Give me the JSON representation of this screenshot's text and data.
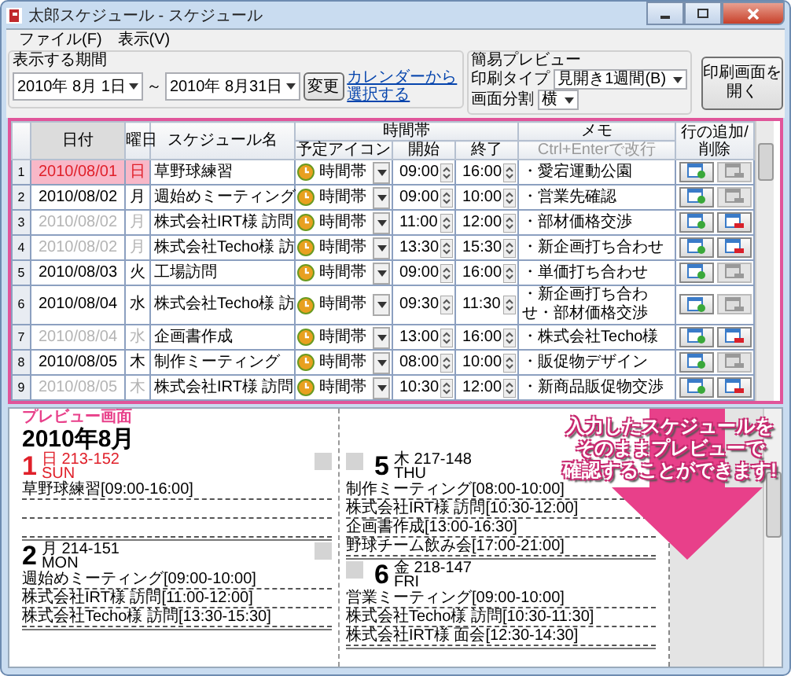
{
  "window": {
    "title": "太郎スケジュール - スケジュール"
  },
  "menu": [
    "ファイル(F)",
    "表示(V)"
  ],
  "period": {
    "label": "表示する期間",
    "from": "2010年 8月 1日",
    "separator": "～",
    "to": "2010年 8月31日",
    "change_button": "変更",
    "calendar_link": "カレンダーから選択する"
  },
  "preview_settings": {
    "label": "簡易プレビュー",
    "print_type_label": "印刷タイプ",
    "print_type": "見開き1週間(B)",
    "split_label": "画面分割",
    "split": "横"
  },
  "open_print_button": "印刷画面を開く",
  "grid": {
    "headers": {
      "date": "日付",
      "weekday": "曜日",
      "name": "スケジュール名",
      "time_group": "時間帯",
      "icon": "予定アイコン",
      "start": "開始",
      "end": "終了",
      "memo": "メモ",
      "memo_hint": "Ctrl+Enterで改行",
      "actions": "行の追加/削除"
    },
    "rows": [
      {
        "no": "1",
        "date": "2010/08/01",
        "weekday": "日",
        "name": "草野球練習",
        "icon_label": "時間帯",
        "start": "09:00",
        "end": "16:00",
        "memo": "・愛宕運動公園",
        "greyed": false,
        "selected": true,
        "holiday": true,
        "can_delete": false
      },
      {
        "no": "2",
        "date": "2010/08/02",
        "weekday": "月",
        "name": "週始めミーティング",
        "icon_label": "時間帯",
        "start": "09:00",
        "end": "10:00",
        "memo": "・営業先確認",
        "greyed": false,
        "selected": false,
        "holiday": false,
        "can_delete": false
      },
      {
        "no": "3",
        "date": "2010/08/02",
        "weekday": "月",
        "name": "株式会社IRT様 訪問",
        "icon_label": "時間帯",
        "start": "11:00",
        "end": "12:00",
        "memo": "・部材価格交渉",
        "greyed": true,
        "selected": false,
        "holiday": false,
        "can_delete": true
      },
      {
        "no": "4",
        "date": "2010/08/02",
        "weekday": "月",
        "name": "株式会社Techo様 訪",
        "icon_label": "時間帯",
        "start": "13:30",
        "end": "15:30",
        "memo": "・新企画打ち合わせ",
        "greyed": true,
        "selected": false,
        "holiday": false,
        "can_delete": true
      },
      {
        "no": "5",
        "date": "2010/08/03",
        "weekday": "火",
        "name": "工場訪問",
        "icon_label": "時間帯",
        "start": "09:00",
        "end": "16:00",
        "memo": "・単価打ち合わせ",
        "greyed": false,
        "selected": false,
        "holiday": false,
        "can_delete": false
      },
      {
        "no": "6",
        "date": "2010/08/04",
        "weekday": "水",
        "name": "株式会社Techo様 訪",
        "icon_label": "時間帯",
        "start": "09:30",
        "end": "11:30",
        "memo": "・新企画打ち合わせ・部材価格交渉",
        "greyed": false,
        "selected": false,
        "holiday": false,
        "can_delete": false
      },
      {
        "no": "7",
        "date": "2010/08/04",
        "weekday": "水",
        "name": "企画書作成",
        "icon_label": "時間帯",
        "start": "13:00",
        "end": "16:00",
        "memo": "・株式会社Techo様",
        "greyed": true,
        "selected": false,
        "holiday": false,
        "can_delete": true
      },
      {
        "no": "8",
        "date": "2010/08/05",
        "weekday": "木",
        "name": "制作ミーティング",
        "icon_label": "時間帯",
        "start": "08:00",
        "end": "10:00",
        "memo": "・販促物デザイン",
        "greyed": false,
        "selected": false,
        "holiday": false,
        "can_delete": false
      },
      {
        "no": "9",
        "date": "2010/08/05",
        "weekday": "木",
        "name": "株式会社IRT様 訪問",
        "icon_label": "時間帯",
        "start": "10:30",
        "end": "12:00",
        "memo": "・新商品販促物交渉",
        "greyed": true,
        "selected": false,
        "holiday": false,
        "can_delete": true
      }
    ]
  },
  "preview": {
    "label": "プレビュー画面",
    "month": "2010年8月",
    "columns": [
      [
        {
          "day": "1",
          "weekday": "日",
          "count": "213-152",
          "dow": "SUN",
          "holiday": true,
          "entries": [
            "草野球練習[09:00-16:00]"
          ]
        },
        {
          "day": "2",
          "weekday": "月",
          "count": "214-151",
          "dow": "MON",
          "holiday": false,
          "entries": [
            "週始めミーティング[09:00-10:00]",
            "株式会社IRT様 訪問[11:00-12:00]",
            "株式会社Techo様 訪問[13:30-15:30]"
          ]
        }
      ],
      [
        {
          "day": "5",
          "weekday": "木",
          "count": "217-148",
          "dow": "THU",
          "holiday": false,
          "entries": [
            "制作ミーティング[08:00-10:00]",
            "株式会社IRT様 訪問[10:30-12:00]",
            "企画書作成[13:00-16:30]",
            "野球チーム飲み会[17:00-21:00]"
          ]
        },
        {
          "day": "6",
          "weekday": "金",
          "count": "218-147",
          "dow": "FRI",
          "holiday": false,
          "entries": [
            "営業ミーティング[09:00-10:00]",
            "株式会社Techo様 訪問[10:30-11:30]",
            "株式会社IRT様 面会[12:30-14:30]"
          ]
        }
      ]
    ]
  },
  "callout": [
    "入力したスケジュールを",
    "そのままプレビューで",
    "確認することができます!"
  ]
}
